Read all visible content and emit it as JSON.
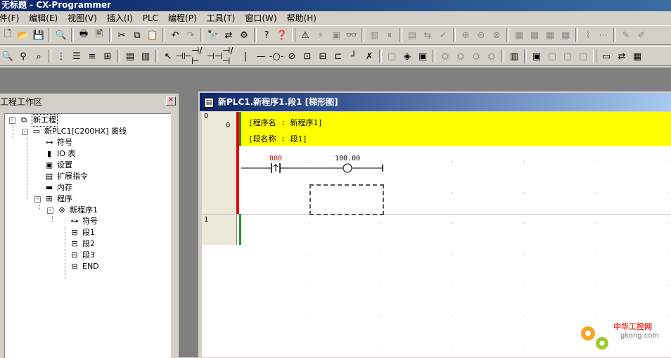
{
  "window": {
    "title": "无标题 - CX-Programmer"
  },
  "menu": [
    "件(F)",
    "编辑(E)",
    "视图(V)",
    "插入(I)",
    "PLC",
    "编程(P)",
    "工具(T)",
    "窗口(W)",
    "帮助(H)"
  ],
  "toolbar1": [
    {
      "name": "new-icon",
      "glyph": "🗋"
    },
    {
      "name": "open-icon",
      "glyph": "📂"
    },
    {
      "name": "save-icon",
      "glyph": "💾"
    },
    {
      "sep": true
    },
    {
      "name": "print-preview-icon",
      "glyph": "🔍"
    },
    {
      "sep": true
    },
    {
      "name": "print-icon",
      "glyph": "🖶"
    },
    {
      "name": "print-setup-icon",
      "glyph": "🖹"
    },
    {
      "sep": true
    },
    {
      "name": "cut-icon",
      "glyph": "✂"
    },
    {
      "name": "copy-icon",
      "glyph": "⧉"
    },
    {
      "name": "paste-icon",
      "glyph": "📋"
    },
    {
      "sep": true
    },
    {
      "name": "undo-icon",
      "glyph": "↶"
    },
    {
      "name": "redo-icon",
      "glyph": "↷",
      "dim": true
    },
    {
      "sep": true
    },
    {
      "name": "find-icon",
      "glyph": "🔭"
    },
    {
      "name": "replace-icon",
      "glyph": "⇄"
    },
    {
      "name": "address-reference-icon",
      "glyph": "⚙"
    },
    {
      "sep": true
    },
    {
      "name": "help-icon",
      "glyph": "?"
    },
    {
      "name": "context-help-icon",
      "glyph": "❓"
    },
    {
      "grip": true
    },
    {
      "name": "warning-icon",
      "glyph": "⚠"
    },
    {
      "name": "online-icon",
      "glyph": "⚡",
      "dim": true
    },
    {
      "name": "monitor-icon",
      "glyph": "▣",
      "dim": true
    },
    {
      "name": "binoculars-icon",
      "glyph": "👓",
      "dim": true
    },
    {
      "sep": true
    },
    {
      "name": "run-mode-icon",
      "glyph": "▥",
      "dim": true
    },
    {
      "name": "pause-icon",
      "glyph": "⏸",
      "dim": true
    },
    {
      "sep": true
    },
    {
      "name": "compare-icon",
      "glyph": "▤",
      "dim": true
    },
    {
      "name": "transfer-icon",
      "glyph": "⇆",
      "dim": true
    },
    {
      "name": "verify-icon",
      "glyph": "✓",
      "dim": true
    },
    {
      "sep": true
    },
    {
      "name": "force-on-icon",
      "glyph": "⊕",
      "dim": true
    },
    {
      "name": "force-off-icon",
      "glyph": "⊖",
      "dim": true
    },
    {
      "name": "force-cancel-icon",
      "glyph": "⊗",
      "dim": true
    },
    {
      "sep": true
    },
    {
      "name": "memory-icon",
      "glyph": "▦",
      "dim": true
    },
    {
      "name": "io-table-icon",
      "glyph": "▦",
      "dim": true
    },
    {
      "name": "settings-icon",
      "glyph": "▦",
      "dim": true
    },
    {
      "name": "clock-icon",
      "glyph": "▦",
      "dim": true
    },
    {
      "sep": true
    },
    {
      "name": "differential-monitor-icon",
      "glyph": "⌇",
      "dim": true
    },
    {
      "name": "data-trace-icon",
      "glyph": "⋯",
      "dim": true
    },
    {
      "sep": true
    },
    {
      "name": "online-edit-icon",
      "glyph": "✎",
      "dim": true
    },
    {
      "name": "online-edit-send-icon",
      "glyph": "✐",
      "dim": true
    }
  ],
  "toolbar2": [
    {
      "name": "zoom-in-icon",
      "glyph": "🔍"
    },
    {
      "name": "zoom-out-icon",
      "glyph": "⚲"
    },
    {
      "name": "zoom-icon",
      "glyph": "⌕"
    },
    {
      "sep": true
    },
    {
      "name": "grid-icon",
      "glyph": "⋮"
    },
    {
      "name": "show-comments-icon",
      "glyph": "☰"
    },
    {
      "name": "rung-annotation-icon",
      "glyph": "≡"
    },
    {
      "name": "monitor-window-icon",
      "glyph": "⊞"
    },
    {
      "sep": true
    },
    {
      "name": "ladder-view-icon",
      "glyph": "▤"
    },
    {
      "name": "mnemonic-view-icon",
      "glyph": "▥"
    },
    {
      "sep": true
    },
    {
      "name": "select-mode-icon",
      "glyph": "↖"
    },
    {
      "name": "contact-icon",
      "glyph": "⊣⊢"
    },
    {
      "name": "closed-contact-icon",
      "glyph": "⊣/⊢"
    },
    {
      "name": "or-contact-icon",
      "glyph": "⊣⊣"
    },
    {
      "name": "or-closed-contact-icon",
      "glyph": "⊣/⊣"
    },
    {
      "name": "vertical-line-icon",
      "glyph": "|"
    },
    {
      "name": "horizontal-line-icon",
      "glyph": "—"
    },
    {
      "name": "coil-icon",
      "glyph": "-○-"
    },
    {
      "name": "closed-coil-icon",
      "glyph": "⊘"
    },
    {
      "name": "instruction-icon",
      "glyph": "⊡"
    },
    {
      "name": "pmcr-icon",
      "glyph": "⊟"
    },
    {
      "name": "pmcr2-icon",
      "glyph": "⊏"
    },
    {
      "name": "line-connect-icon",
      "glyph": "┘"
    },
    {
      "name": "line-delete-icon",
      "glyph": "✗"
    },
    {
      "sep": true
    },
    {
      "name": "symbol-table-icon",
      "glyph": "▢",
      "dim": true
    },
    {
      "name": "rung-edit-icon",
      "glyph": "◈"
    },
    {
      "name": "symbol-manage-icon",
      "glyph": "▣"
    },
    {
      "sep": true
    },
    {
      "name": "compile-icon",
      "glyph": "⛭",
      "dim": true
    },
    {
      "name": "compile-all-icon",
      "glyph": "⛭",
      "dim": true
    },
    {
      "name": "check-program-icon",
      "glyph": "⛭",
      "dim": true
    },
    {
      "name": "check-all-icon",
      "glyph": "⛭",
      "dim": true
    },
    {
      "sep": true
    },
    {
      "name": "cross-reference-icon",
      "glyph": "▥"
    },
    {
      "sep": true
    },
    {
      "name": "window-list-icon",
      "glyph": "▣"
    },
    {
      "name": "window-cascade-icon",
      "glyph": "▢",
      "dim": true
    },
    {
      "name": "window-tile-icon",
      "glyph": "▢",
      "dim": true
    },
    {
      "name": "window-arrange-icon",
      "glyph": "▢",
      "dim": true
    },
    {
      "grip": true
    },
    {
      "name": "task-icon",
      "glyph": "▭"
    },
    {
      "name": "address-icon",
      "glyph": "⇄"
    },
    {
      "name": "program-icon",
      "glyph": "▦"
    }
  ],
  "project_panel": {
    "title": "工程工作区",
    "tree": [
      {
        "label": "新工程",
        "level": 0,
        "icon": "project-icon",
        "glyph": "⧉",
        "expander": "-"
      },
      {
        "label": "新PLC1[C200HX] 离线",
        "level": 1,
        "icon": "plc-icon",
        "glyph": "▭",
        "expander": "-"
      },
      {
        "label": "符号",
        "level": 2,
        "icon": "symbols-icon",
        "glyph": "⊶"
      },
      {
        "label": "IO 表",
        "level": 2,
        "icon": "io-table-icon",
        "glyph": "▮"
      },
      {
        "label": "设置",
        "level": 2,
        "icon": "settings-icon",
        "glyph": "▣"
      },
      {
        "label": "扩展指令",
        "level": 2,
        "icon": "expansion-instructions-icon",
        "glyph": "▤"
      },
      {
        "label": "内存",
        "level": 2,
        "icon": "memory-icon",
        "glyph": "▬"
      },
      {
        "label": "程序",
        "level": 2,
        "icon": "programs-icon",
        "glyph": "⊞",
        "expander": "-"
      },
      {
        "label": "新程序1",
        "level": 3,
        "icon": "program-icon",
        "glyph": "⊛",
        "expander": "-"
      },
      {
        "label": "符号",
        "level": 4,
        "icon": "symbols-icon",
        "glyph": "⊶"
      },
      {
        "label": "段1",
        "level": 4,
        "icon": "section-icon",
        "glyph": "⊟"
      },
      {
        "label": "段2",
        "level": 4,
        "icon": "section-icon",
        "glyph": "⊟"
      },
      {
        "label": "段3",
        "level": 4,
        "icon": "section-icon",
        "glyph": "⊟"
      },
      {
        "label": "END",
        "level": 4,
        "icon": "section-end-icon",
        "glyph": "⊟"
      }
    ]
  },
  "ladder": {
    "title": "新PLC1.新程序1.段1 [梯形图]",
    "rung0_num": "0",
    "rung0_step": "0",
    "program_name": "[程序名 : 新程序1]",
    "section_name": "[段名称 : 段1]",
    "contact_address": "000",
    "coil_address": "100.00",
    "rung1_num": "1"
  },
  "colors": {
    "comment_band": "#ffff00",
    "power_rail": "#e00000",
    "rung_marker": "#2e8b2e"
  },
  "watermark": {
    "name": "中华工控网",
    "url": "gkong.com"
  }
}
